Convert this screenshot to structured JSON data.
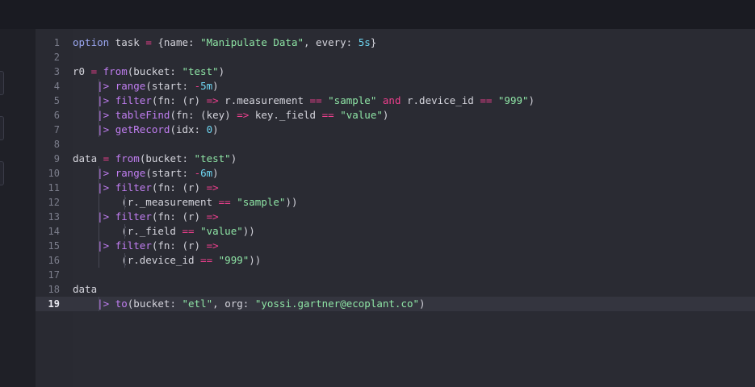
{
  "editor": {
    "active_line": 19,
    "lines": [
      {
        "n": "1",
        "tokens": [
          [
            "kw",
            "option"
          ],
          [
            "plain",
            " task "
          ],
          [
            "op",
            "="
          ],
          [
            "plain",
            " {name: "
          ],
          [
            "str",
            "\"Manipulate Data\""
          ],
          [
            "plain",
            ", every: "
          ],
          [
            "num",
            "5s"
          ],
          [
            "plain",
            "}"
          ]
        ]
      },
      {
        "n": "2",
        "tokens": []
      },
      {
        "n": "3",
        "tokens": [
          [
            "plain",
            "r0 "
          ],
          [
            "op",
            "="
          ],
          [
            "plain",
            " "
          ],
          [
            "fn",
            "from"
          ],
          [
            "plain",
            "(bucket: "
          ],
          [
            "str",
            "\"test\""
          ],
          [
            "plain",
            ")"
          ]
        ]
      },
      {
        "n": "4",
        "tokens": [
          [
            "plain",
            "    "
          ],
          [
            "pipe",
            "|>"
          ],
          [
            "plain",
            " "
          ],
          [
            "fn",
            "range"
          ],
          [
            "plain",
            "(start: "
          ],
          [
            "op",
            "-"
          ],
          [
            "num",
            "5m"
          ],
          [
            "plain",
            ")"
          ]
        ]
      },
      {
        "n": "5",
        "tokens": [
          [
            "plain",
            "    "
          ],
          [
            "pipe",
            "|>"
          ],
          [
            "plain",
            " "
          ],
          [
            "fn",
            "filter"
          ],
          [
            "plain",
            "(fn: (r) "
          ],
          [
            "op",
            "=>"
          ],
          [
            "plain",
            " r.measurement "
          ],
          [
            "op",
            "=="
          ],
          [
            "plain",
            " "
          ],
          [
            "str",
            "\"sample\""
          ],
          [
            "plain",
            " "
          ],
          [
            "op",
            "and"
          ],
          [
            "plain",
            " r.device_id "
          ],
          [
            "op",
            "=="
          ],
          [
            "plain",
            " "
          ],
          [
            "str",
            "\"999\""
          ],
          [
            "plain",
            ")"
          ]
        ]
      },
      {
        "n": "6",
        "tokens": [
          [
            "plain",
            "    "
          ],
          [
            "pipe",
            "|>"
          ],
          [
            "plain",
            " "
          ],
          [
            "fn",
            "tableFind"
          ],
          [
            "plain",
            "(fn: (key) "
          ],
          [
            "op",
            "=>"
          ],
          [
            "plain",
            " key._field "
          ],
          [
            "op",
            "=="
          ],
          [
            "plain",
            " "
          ],
          [
            "str",
            "\"value\""
          ],
          [
            "plain",
            ")"
          ]
        ]
      },
      {
        "n": "7",
        "tokens": [
          [
            "plain",
            "    "
          ],
          [
            "pipe",
            "|>"
          ],
          [
            "plain",
            " "
          ],
          [
            "fn",
            "getRecord"
          ],
          [
            "plain",
            "(idx: "
          ],
          [
            "num",
            "0"
          ],
          [
            "plain",
            ")"
          ]
        ]
      },
      {
        "n": "8",
        "tokens": []
      },
      {
        "n": "9",
        "tokens": [
          [
            "plain",
            "data "
          ],
          [
            "op",
            "="
          ],
          [
            "plain",
            " "
          ],
          [
            "fn",
            "from"
          ],
          [
            "plain",
            "(bucket: "
          ],
          [
            "str",
            "\"test\""
          ],
          [
            "plain",
            ")"
          ]
        ]
      },
      {
        "n": "10",
        "tokens": [
          [
            "plain",
            "    "
          ],
          [
            "pipe",
            "|>"
          ],
          [
            "plain",
            " "
          ],
          [
            "fn",
            "range"
          ],
          [
            "plain",
            "(start: "
          ],
          [
            "op",
            "-"
          ],
          [
            "num",
            "6m"
          ],
          [
            "plain",
            ")"
          ]
        ]
      },
      {
        "n": "11",
        "tokens": [
          [
            "plain",
            "    "
          ],
          [
            "pipe",
            "|>"
          ],
          [
            "plain",
            " "
          ],
          [
            "fn",
            "filter"
          ],
          [
            "plain",
            "(fn: (r) "
          ],
          [
            "op",
            "=>"
          ]
        ]
      },
      {
        "n": "12",
        "tokens": [
          [
            "plain",
            "        (r._measurement "
          ],
          [
            "op",
            "=="
          ],
          [
            "plain",
            " "
          ],
          [
            "str",
            "\"sample\""
          ],
          [
            "plain",
            "))"
          ]
        ]
      },
      {
        "n": "13",
        "tokens": [
          [
            "plain",
            "    "
          ],
          [
            "pipe",
            "|>"
          ],
          [
            "plain",
            " "
          ],
          [
            "fn",
            "filter"
          ],
          [
            "plain",
            "(fn: (r) "
          ],
          [
            "op",
            "=>"
          ]
        ]
      },
      {
        "n": "14",
        "tokens": [
          [
            "plain",
            "        (r._field "
          ],
          [
            "op",
            "=="
          ],
          [
            "plain",
            " "
          ],
          [
            "str",
            "\"value\""
          ],
          [
            "plain",
            "))"
          ]
        ]
      },
      {
        "n": "15",
        "tokens": [
          [
            "plain",
            "    "
          ],
          [
            "pipe",
            "|>"
          ],
          [
            "plain",
            " "
          ],
          [
            "fn",
            "filter"
          ],
          [
            "plain",
            "(fn: (r) "
          ],
          [
            "op",
            "=>"
          ]
        ]
      },
      {
        "n": "16",
        "tokens": [
          [
            "plain",
            "        (r.device_id "
          ],
          [
            "op",
            "=="
          ],
          [
            "plain",
            " "
          ],
          [
            "str",
            "\"999\""
          ],
          [
            "plain",
            "))"
          ]
        ]
      },
      {
        "n": "17",
        "tokens": []
      },
      {
        "n": "18",
        "tokens": [
          [
            "plain",
            "data"
          ]
        ]
      },
      {
        "n": "19",
        "tokens": [
          [
            "plain",
            "    "
          ],
          [
            "pipe",
            "|>"
          ],
          [
            "plain",
            " "
          ],
          [
            "fn",
            "to"
          ],
          [
            "plain",
            "(bucket: "
          ],
          [
            "str",
            "\"etl\""
          ],
          [
            "plain",
            ", org: "
          ],
          [
            "str",
            "\"yossi.gartner@ecoplant.co\""
          ],
          [
            "plain",
            ")"
          ]
        ]
      }
    ]
  },
  "colors": {
    "background": "#2a2b33",
    "keyword": "#9aa6f0",
    "operator": "#ef3f8e",
    "function": "#c17ef2",
    "string": "#8ee4a5",
    "number": "#6fd6f2"
  }
}
